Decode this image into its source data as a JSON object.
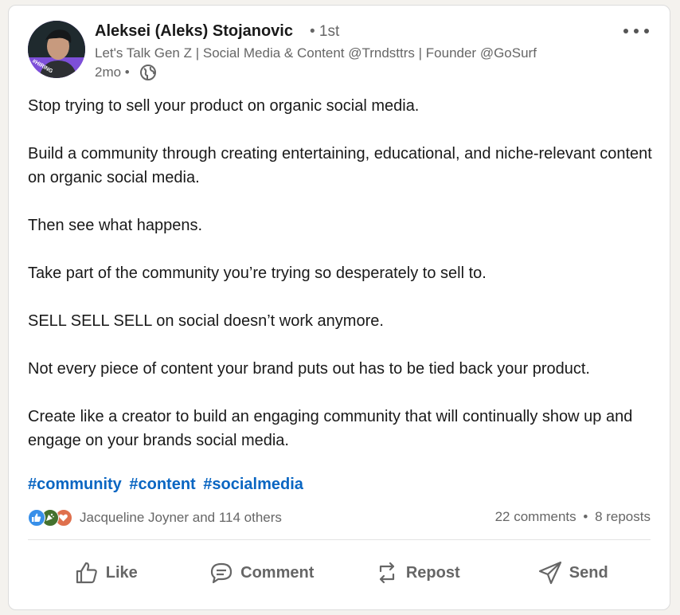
{
  "post": {
    "author": {
      "name": "Aleksei (Aleks) Stojanovic",
      "degree": "• 1st",
      "headline": "Let's Talk Gen Z | Social Media & Content @Trndsttrs | Founder @GoSurf",
      "timestamp": "2mo •",
      "avatar_badge": "#HIRING"
    },
    "body": [
      "Stop trying to sell your product on organic social media.",
      "Build a community through creating entertaining, educational, and niche-relevant content on organic social media.",
      "Then see what happens.",
      "Take part of the community you’re trying so desperately to sell to.",
      "SELL SELL SELL on social doesn’t work anymore.",
      "Not every piece of content your brand puts out has to be tied back your product.",
      "Create like a creator to build an engaging community that will continually show up and engage on your brands social media."
    ],
    "hashtags": [
      "#community",
      "#content",
      "#socialmedia"
    ],
    "social": {
      "reactors": "Jacqueline Joyner and 114 others",
      "comments": "22 comments",
      "separator": "•",
      "reposts": "8 reposts"
    },
    "actions": {
      "like": "Like",
      "comment": "Comment",
      "repost": "Repost",
      "send": "Send"
    }
  },
  "icons": [
    "more-icon",
    "globe-icon",
    "like-reaction-icon",
    "celebrate-reaction-icon",
    "love-reaction-icon",
    "thumbs-up-icon",
    "comment-icon",
    "repost-icon",
    "send-icon"
  ],
  "colors": {
    "link": "#0a66c2",
    "muted": "#666666",
    "like": "#378fe9",
    "celebrate": "#44712e",
    "love": "#df704d"
  }
}
